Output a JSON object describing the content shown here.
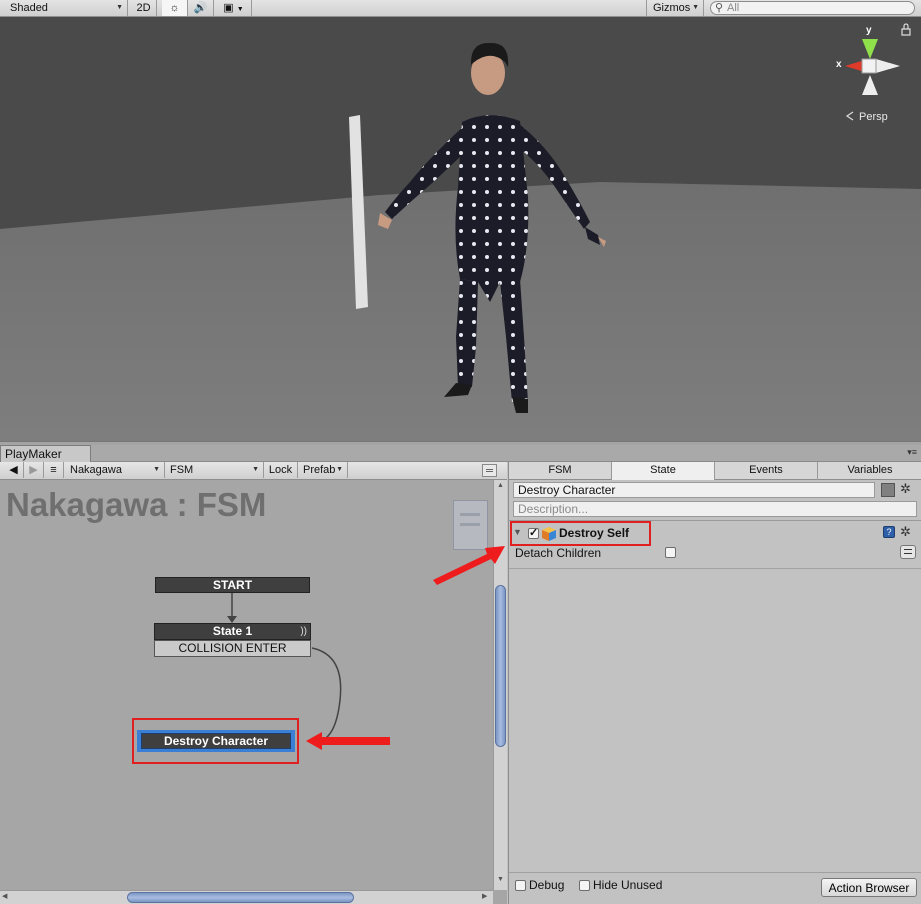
{
  "scene_toolbar": {
    "shading_mode": "Shaded",
    "mode_2d": "2D",
    "gizmos_label": "Gizmos",
    "search_placeholder": "All"
  },
  "scene": {
    "gizmo_y": "y",
    "gizmo_x": "x",
    "projection_label": "Persp"
  },
  "window_tab": "PlayMaker",
  "graph_toolbar": {
    "gameobject": "Nakagawa",
    "fsm": "FSM",
    "lock_label": "Lock",
    "prefab_label": "Prefab"
  },
  "graph": {
    "title": "Nakagawa : FSM",
    "start_label": "START",
    "state1_name": "State 1",
    "state1_transition": "COLLISION ENTER",
    "destroy_state": "Destroy Character"
  },
  "inspector": {
    "tabs": [
      "FSM",
      "State",
      "Events",
      "Variables"
    ],
    "active_tab": "State",
    "state_name": "Destroy Character",
    "description_placeholder": "Description...",
    "action_name": "Destroy Self",
    "param_label": "Detach Children",
    "debug_label": "Debug",
    "hide_unused_label": "Hide Unused",
    "action_browser_label": "Action Browser"
  },
  "colors": {
    "highlight_red": "#e02020",
    "selected_blue": "#3a7fd5"
  }
}
